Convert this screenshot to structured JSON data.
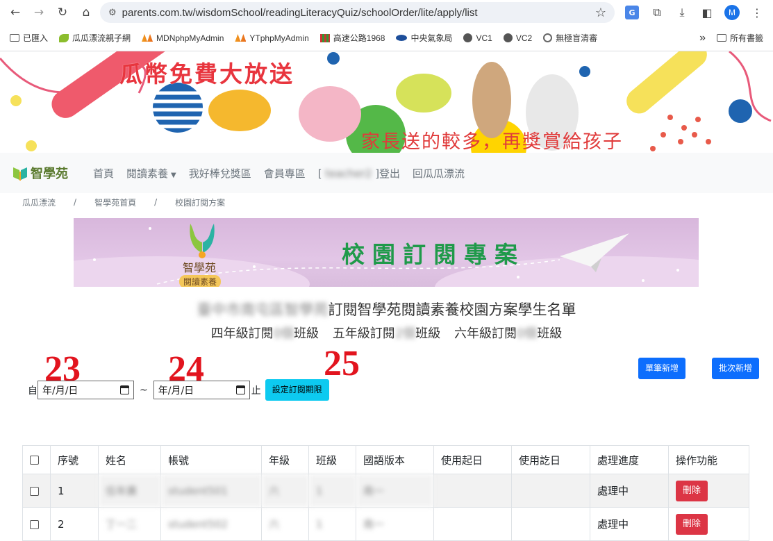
{
  "browser": {
    "url": "parents.com.tw/wisdomSchool/readingLiteracyQuiz/schoolOrder/lite/apply/list",
    "avatar_letter": "M",
    "translate_label": "G",
    "bookmarks": [
      "已匯入",
      "瓜瓜漂流親子網",
      "MDNphpMyAdmin",
      "YTphpMyAdmin",
      "高速公路1968",
      "中央氣象局",
      "VC1",
      "VC2",
      "無極盲清審"
    ],
    "bookmarks_overflow": "»",
    "all_bookmarks": "所有書籤"
  },
  "banner": {
    "title": "瓜幣免費大放送",
    "subtitle": "家長送的較多，再獎賞給孩子"
  },
  "sitenav": {
    "brand": "智學苑",
    "links": [
      "首頁",
      "閱讀素養",
      "我好棒兌獎區",
      "會員專區"
    ],
    "account_prefix": "[",
    "account_name": "teacher2",
    "account_suffix": "]登出",
    "back_link": "回瓜瓜漂流"
  },
  "breadcrumb": [
    "瓜瓜漂流",
    "智學苑首頁",
    "校園訂閱方案"
  ],
  "plan_banner": {
    "title": "校園訂閱專案",
    "logo_text": "智學苑",
    "logo_sub": "閱讀素養"
  },
  "heading": {
    "school": "臺中市南屯區智學苑",
    "title": "訂閱智學苑閱讀素養校園方案學生名單",
    "g4_prefix": "四年級訂閱",
    "g4_count": "0個",
    "g4_suffix": "班級",
    "g5_prefix": "五年級訂閱",
    "g5_count": "2個",
    "g5_suffix": "班級",
    "g6_prefix": "六年級訂閱",
    "g6_count": "0個",
    "g6_suffix": "班級"
  },
  "annotations": [
    "23",
    "24",
    "25"
  ],
  "filter": {
    "from_label": "自",
    "date_placeholder": "年/月/日",
    "tilde": "~",
    "to_label": "止",
    "set_button": "設定訂閱期限"
  },
  "actions": {
    "single_add": "單筆新增",
    "batch_add": "批次新增"
  },
  "table": {
    "headers": [
      "序號",
      "姓名",
      "帳號",
      "年級",
      "班級",
      "國語版本",
      "使用起日",
      "使用訖日",
      "處理進度",
      "操作功能"
    ],
    "rows": [
      {
        "no": "1",
        "name": "伍年廣",
        "account": "student501",
        "grade": "六",
        "class": "1",
        "edition": "南一",
        "start": "",
        "end": "",
        "status": "處理中",
        "action": "刪除"
      },
      {
        "no": "2",
        "name": "丁一二",
        "account": "student502",
        "grade": "六",
        "class": "1",
        "edition": "南一",
        "start": "",
        "end": "",
        "status": "處理中",
        "action": "刪除"
      }
    ]
  },
  "colors": {
    "banner_title": "#e8353e",
    "plan_title": "#1f9a4a",
    "annotation": "#e2141e",
    "btn_primary": "#0d6efd",
    "btn_info": "#0dcaf0",
    "btn_danger": "#dc3545"
  }
}
